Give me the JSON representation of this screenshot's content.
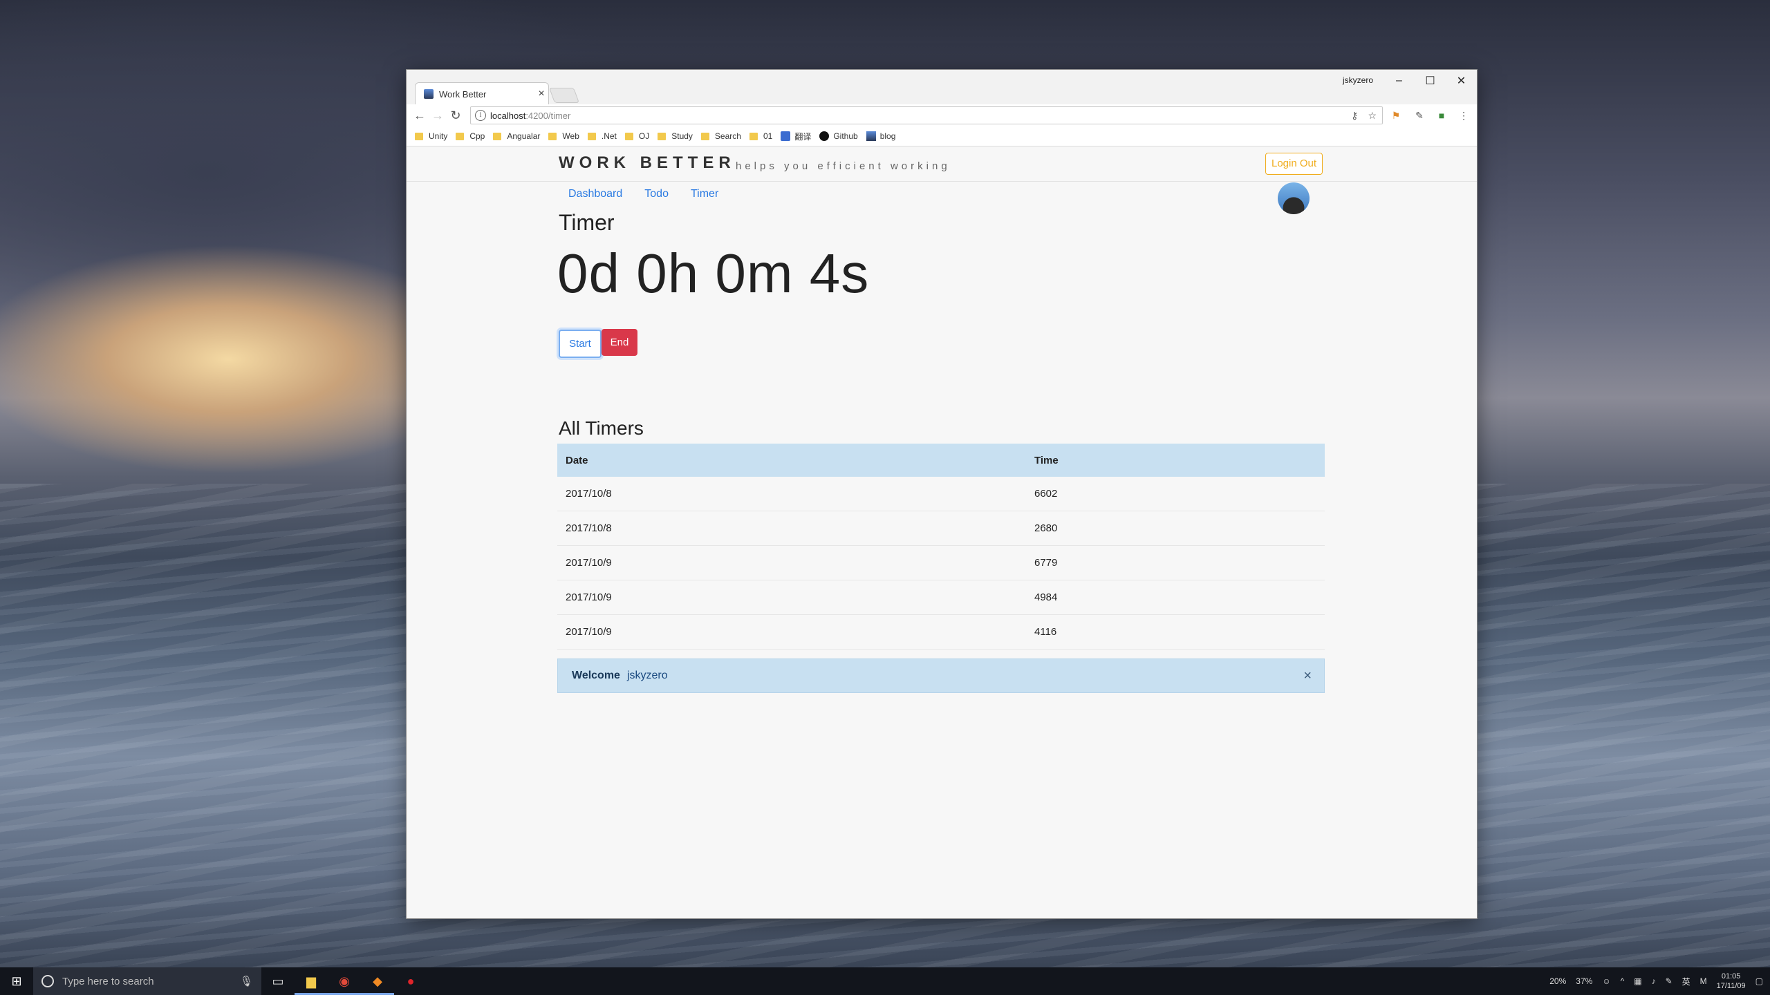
{
  "browser": {
    "tab_title": "Work Better",
    "tab_close": "×",
    "profile": "jskyzero",
    "url_host": "localhost",
    "url_path": ":4200/timer",
    "bookmarks": [
      "Unity",
      "Cpp",
      "Angualar",
      "Web",
      ".Net",
      "OJ",
      "Study",
      "Search",
      "01",
      "翻译",
      "Github",
      "blog"
    ]
  },
  "app": {
    "brand": "WORK BETTER",
    "tagline": "helps you efficient working",
    "logout_label": "Login Out",
    "nav": [
      "Dashboard",
      "Todo",
      "Timer"
    ],
    "heading": "Timer",
    "clock": "0d 0h 0m 4s",
    "start_label": "Start",
    "end_label": "End",
    "all_heading": "All Timers",
    "table": {
      "headers": [
        "Date",
        "Time"
      ],
      "rows": [
        [
          "2017/10/8",
          "6602"
        ],
        [
          "2017/10/8",
          "2680"
        ],
        [
          "2017/10/9",
          "6779"
        ],
        [
          "2017/10/9",
          "4984"
        ],
        [
          "2017/10/9",
          "4116"
        ]
      ]
    },
    "alert": {
      "title": "Welcome",
      "user": "jskyzero",
      "close": "×"
    }
  },
  "taskbar": {
    "search_placeholder": "Type here to search",
    "cpu": "20%",
    "mem": "37%",
    "time": "01:05",
    "date": "17/11/09"
  },
  "colors": {
    "accent": "#2a7ae2",
    "danger": "#d9384a",
    "warning": "#f0ad1e",
    "info_bg": "#c8e0f1"
  }
}
